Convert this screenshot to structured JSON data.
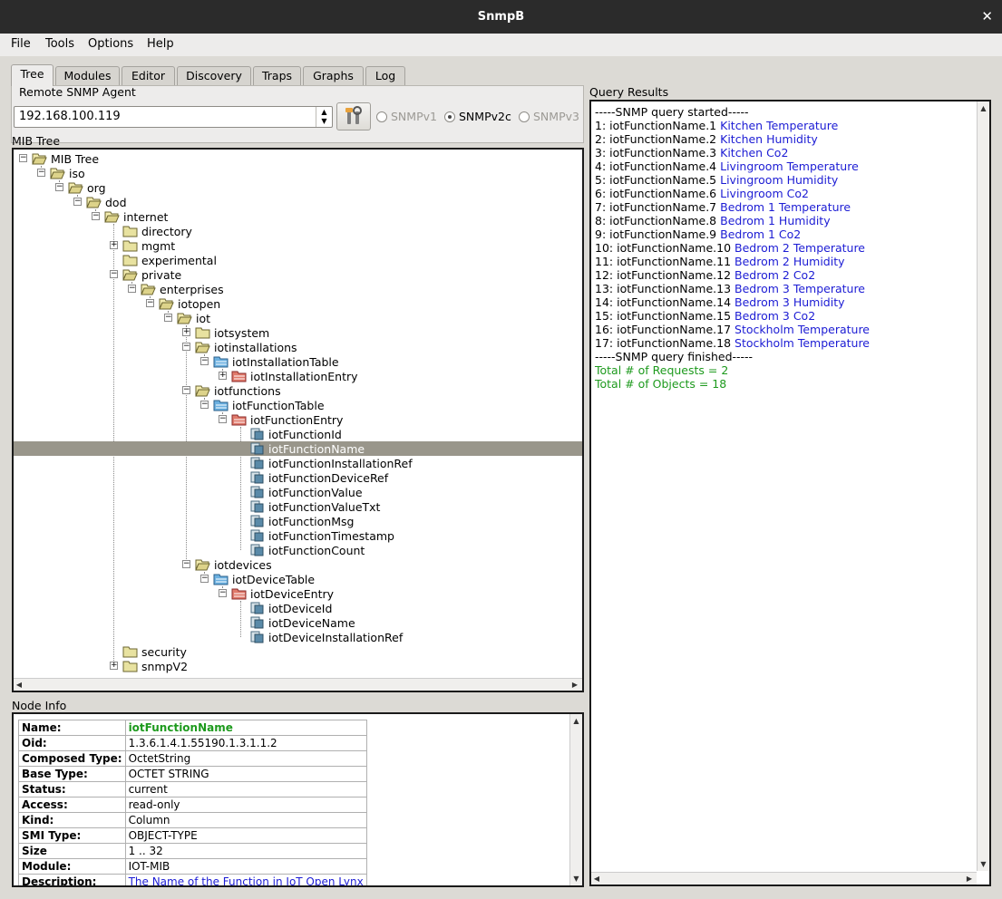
{
  "window": {
    "title": "SnmpB"
  },
  "menu": [
    "File",
    "Tools",
    "Options",
    "Help"
  ],
  "tabs": [
    {
      "label": "Tree",
      "active": true
    },
    {
      "label": "Modules",
      "active": false
    },
    {
      "label": "Editor",
      "active": false
    },
    {
      "label": "Discovery",
      "active": false
    },
    {
      "label": "Traps",
      "active": false
    },
    {
      "label": "Graphs",
      "active": false
    },
    {
      "label": "Log",
      "active": false
    }
  ],
  "agent": {
    "group_label": "Remote SNMP Agent",
    "address": "192.168.100.119",
    "versions": [
      {
        "label": "SNMPv1",
        "checked": false
      },
      {
        "label": "SNMPv2c",
        "checked": true
      },
      {
        "label": "SNMPv3",
        "checked": false
      }
    ]
  },
  "mib_tree": {
    "label": "MIB Tree",
    "nodes": [
      {
        "label": "MIB Tree",
        "depth": 0,
        "icon": "folder-open",
        "expander": "-"
      },
      {
        "label": "iso",
        "depth": 1,
        "icon": "folder-open",
        "expander": "-"
      },
      {
        "label": "org",
        "depth": 2,
        "icon": "folder-open",
        "expander": "-"
      },
      {
        "label": "dod",
        "depth": 3,
        "icon": "folder-open",
        "expander": "-"
      },
      {
        "label": "internet",
        "depth": 4,
        "icon": "folder-open",
        "expander": "-"
      },
      {
        "label": "directory",
        "depth": 5,
        "icon": "folder",
        "expander": ""
      },
      {
        "label": "mgmt",
        "depth": 5,
        "icon": "folder",
        "expander": "+"
      },
      {
        "label": "experimental",
        "depth": 5,
        "icon": "folder",
        "expander": ""
      },
      {
        "label": "private",
        "depth": 5,
        "icon": "folder-open",
        "expander": "-"
      },
      {
        "label": "enterprises",
        "depth": 6,
        "icon": "folder-open",
        "expander": "-"
      },
      {
        "label": "iotopen",
        "depth": 7,
        "icon": "folder-open",
        "expander": "-"
      },
      {
        "label": "iot",
        "depth": 8,
        "icon": "folder-open",
        "expander": "-"
      },
      {
        "label": "iotsystem",
        "depth": 9,
        "icon": "folder",
        "expander": "+"
      },
      {
        "label": "iotinstallations",
        "depth": 9,
        "icon": "folder-open",
        "expander": "-"
      },
      {
        "label": "iotInstallationTable",
        "depth": 10,
        "icon": "table",
        "expander": "-"
      },
      {
        "label": "iotInstallationEntry",
        "depth": 11,
        "icon": "entry",
        "expander": "+"
      },
      {
        "label": "iotfunctions",
        "depth": 9,
        "icon": "folder-open",
        "expander": "-"
      },
      {
        "label": "iotFunctionTable",
        "depth": 10,
        "icon": "table",
        "expander": "-"
      },
      {
        "label": "iotFunctionEntry",
        "depth": 11,
        "icon": "entry",
        "expander": "-"
      },
      {
        "label": "iotFunctionId",
        "depth": 12,
        "icon": "leaf",
        "expander": ""
      },
      {
        "label": "iotFunctionName",
        "depth": 12,
        "icon": "leaf",
        "expander": "",
        "selected": true
      },
      {
        "label": "iotFunctionInstallationRef",
        "depth": 12,
        "icon": "leaf",
        "expander": ""
      },
      {
        "label": "iotFunctionDeviceRef",
        "depth": 12,
        "icon": "leaf",
        "expander": ""
      },
      {
        "label": "iotFunctionValue",
        "depth": 12,
        "icon": "leaf",
        "expander": ""
      },
      {
        "label": "iotFunctionValueTxt",
        "depth": 12,
        "icon": "leaf",
        "expander": ""
      },
      {
        "label": "iotFunctionMsg",
        "depth": 12,
        "icon": "leaf",
        "expander": ""
      },
      {
        "label": "iotFunctionTimestamp",
        "depth": 12,
        "icon": "leaf",
        "expander": ""
      },
      {
        "label": "iotFunctionCount",
        "depth": 12,
        "icon": "leaf",
        "expander": ""
      },
      {
        "label": "iotdevices",
        "depth": 9,
        "icon": "folder-open",
        "expander": "-"
      },
      {
        "label": "iotDeviceTable",
        "depth": 10,
        "icon": "table",
        "expander": "-"
      },
      {
        "label": "iotDeviceEntry",
        "depth": 11,
        "icon": "entry",
        "expander": "-"
      },
      {
        "label": "iotDeviceId",
        "depth": 12,
        "icon": "leaf",
        "expander": ""
      },
      {
        "label": "iotDeviceName",
        "depth": 12,
        "icon": "leaf",
        "expander": ""
      },
      {
        "label": "iotDeviceInstallationRef",
        "depth": 12,
        "icon": "leaf",
        "expander": ""
      },
      {
        "label": "security",
        "depth": 5,
        "icon": "folder",
        "expander": ""
      },
      {
        "label": "snmpV2",
        "depth": 5,
        "icon": "folder",
        "expander": "+"
      }
    ]
  },
  "node_info": {
    "label": "Node Info",
    "rows": [
      {
        "key": "Name:",
        "value": "iotFunctionName",
        "style": "name"
      },
      {
        "key": "Oid:",
        "value": "1.3.6.1.4.1.55190.1.3.1.1.2",
        "style": ""
      },
      {
        "key": "Composed Type:",
        "value": "OctetString",
        "style": ""
      },
      {
        "key": "Base Type:",
        "value": "OCTET STRING",
        "style": ""
      },
      {
        "key": "Status:",
        "value": "current",
        "style": ""
      },
      {
        "key": "Access:",
        "value": "read-only",
        "style": ""
      },
      {
        "key": "Kind:",
        "value": "Column",
        "style": ""
      },
      {
        "key": "SMI Type:",
        "value": "OBJECT-TYPE",
        "style": ""
      },
      {
        "key": "Size",
        "value": "1 .. 32",
        "style": ""
      },
      {
        "key": "Module:",
        "value": "IOT-MIB",
        "style": ""
      },
      {
        "key": "Description:",
        "value": "The Name of the Function in IoT Open Lynx",
        "style": "link"
      }
    ]
  },
  "query_results": {
    "label": "Query Results",
    "header": "-----SNMP query started-----",
    "rows": [
      {
        "oid": "1: iotFunctionName.1",
        "value": "Kitchen Temperature"
      },
      {
        "oid": "2: iotFunctionName.2",
        "value": "Kitchen Humidity"
      },
      {
        "oid": "3: iotFunctionName.3",
        "value": "Kitchen Co2"
      },
      {
        "oid": "4: iotFunctionName.4",
        "value": "Livingroom Temperature"
      },
      {
        "oid": "5: iotFunctionName.5",
        "value": "Livingroom Humidity"
      },
      {
        "oid": "6: iotFunctionName.6",
        "value": "Livingroom Co2"
      },
      {
        "oid": "7: iotFunctionName.7",
        "value": "Bedrom 1 Temperature"
      },
      {
        "oid": "8: iotFunctionName.8",
        "value": "Bedrom 1 Humidity"
      },
      {
        "oid": "9: iotFunctionName.9",
        "value": "Bedrom 1 Co2"
      },
      {
        "oid": "10: iotFunctionName.10",
        "value": "Bedrom 2 Temperature"
      },
      {
        "oid": "11: iotFunctionName.11",
        "value": "Bedrom 2 Humidity"
      },
      {
        "oid": "12: iotFunctionName.12",
        "value": "Bedrom 2 Co2"
      },
      {
        "oid": "13: iotFunctionName.13",
        "value": "Bedrom 3 Temperature"
      },
      {
        "oid": "14: iotFunctionName.14",
        "value": "Bedrom 3 Humidity"
      },
      {
        "oid": "15: iotFunctionName.15",
        "value": "Bedrom 3 Co2"
      },
      {
        "oid": "16: iotFunctionName.17",
        "value": "Stockholm Temperature"
      },
      {
        "oid": "17: iotFunctionName.18",
        "value": "Stockholm Temperature"
      }
    ],
    "footer": "-----SNMP query finished-----",
    "totals": [
      "Total # of Requests = 2",
      "Total # of Objects = 18"
    ]
  }
}
